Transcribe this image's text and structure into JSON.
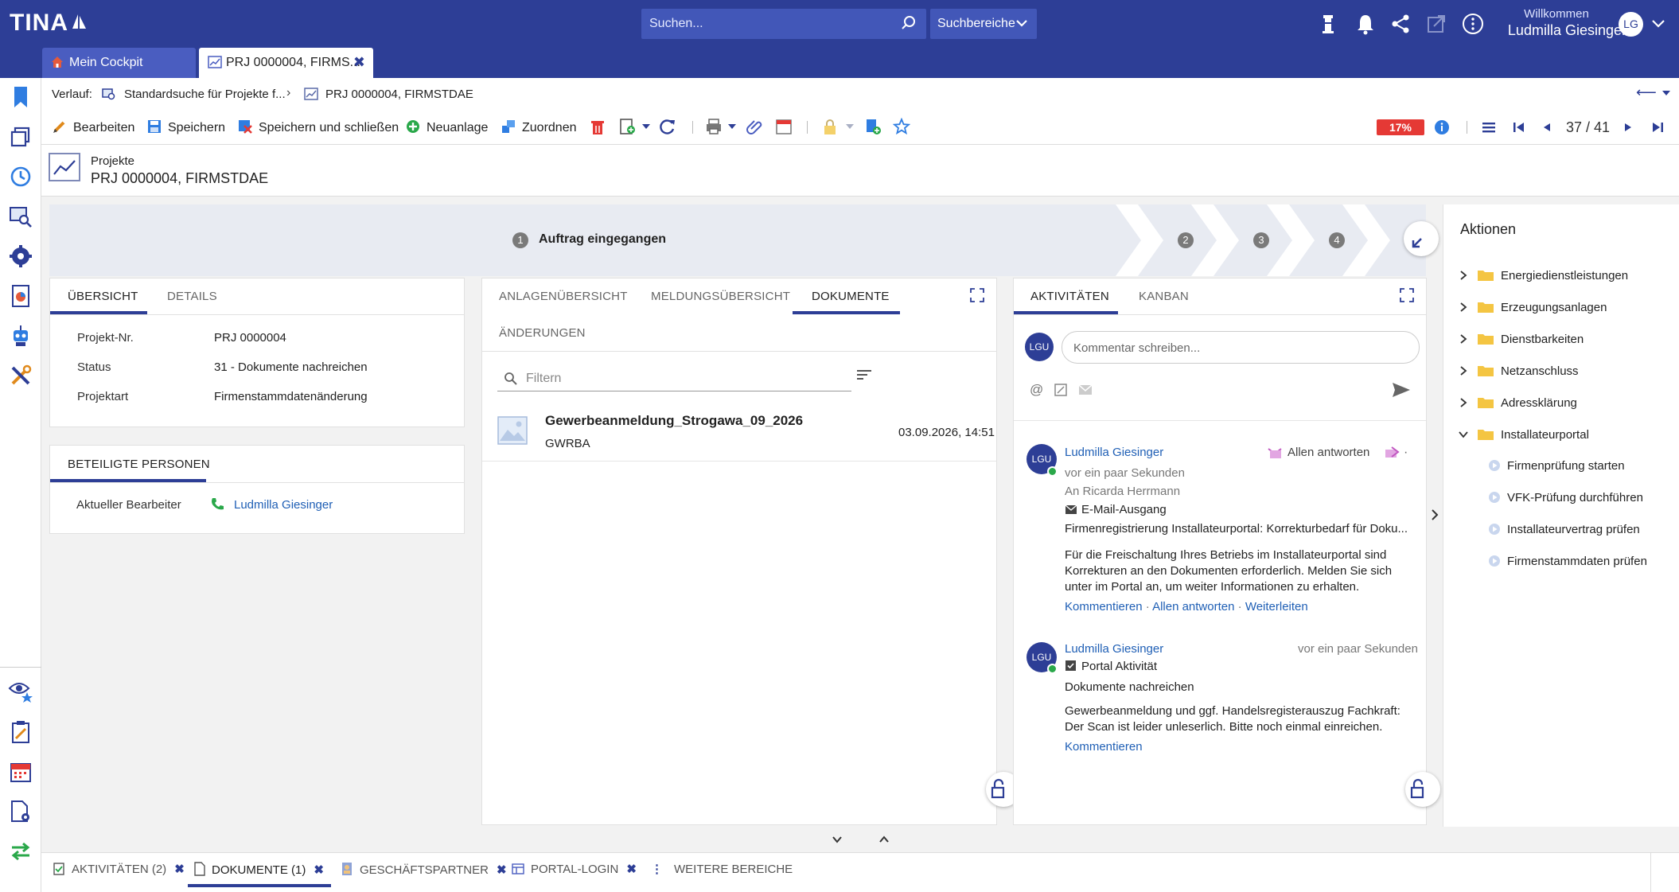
{
  "app": {
    "logo": "TINA"
  },
  "search": {
    "placeholder": "Suchen...",
    "areas_label": "Suchbereiche"
  },
  "user": {
    "welcome": "Willkommen",
    "name": "Ludmilla Giesinger",
    "initials": "LG"
  },
  "window_tabs": [
    {
      "label": "Mein Cockpit"
    },
    {
      "label": "PRJ 0000004, FIRMS..."
    }
  ],
  "breadcrumb": {
    "prefix": "Verlauf:",
    "items": [
      "Standardsuche für Projekte f...",
      "PRJ 0000004, FIRMSTDAE"
    ]
  },
  "toolbar": {
    "edit": "Bearbeiten",
    "save": "Speichern",
    "save_close": "Speichern und schließen",
    "new": "Neuanlage",
    "assign": "Zuordnen",
    "progress_badge": "17%",
    "pager": "37 / 41"
  },
  "record": {
    "type": "Projekte",
    "title": "PRJ 0000004, FIRMSTDAE"
  },
  "stages": [
    {
      "num": "1",
      "label": "Auftrag eingegangen"
    },
    {
      "num": "2"
    },
    {
      "num": "3"
    },
    {
      "num": "4"
    }
  ],
  "overview": {
    "tabs": [
      "ÜBERSICHT",
      "DETAILS"
    ],
    "fields": [
      {
        "label": "Projekt-Nr.",
        "value": "PRJ 0000004"
      },
      {
        "label": "Status",
        "value": "31 - Dokumente nachreichen"
      },
      {
        "label": "Projektart",
        "value": "Firmenstammdatenänderung"
      }
    ]
  },
  "persons": {
    "tab": "BETEILIGTE PERSONEN",
    "label": "Aktueller Bearbeiter",
    "value": "Ludmilla Giesinger"
  },
  "docs": {
    "tabs": [
      "ANLAGENÜBERSICHT",
      "MELDUNGSÜBERSICHT",
      "DOKUMENTE",
      "ÄNDERUNGEN"
    ],
    "filter_placeholder": "Filtern",
    "items": [
      {
        "title": "Gewerbeanmeldung_Strogawa_09_2026",
        "sub": "GWRBA",
        "date": "03.09.2026, 14:51"
      }
    ]
  },
  "activities": {
    "tabs": [
      "AKTIVITÄTEN",
      "KANBAN"
    ],
    "comment_avatar": "LGU",
    "comment_placeholder": "Kommentar schreiben...",
    "entries": [
      {
        "avatar": "LGU",
        "author": "Ludmilla Giesinger",
        "reply_all": "Allen antworten",
        "time": "vor ein paar Sekunden",
        "to": "An Ricarda Herrmann",
        "kind": "E-Mail-Ausgang",
        "subject": "Firmenregistrierung Installateurportal: Korrekturbedarf für Doku...",
        "body": "Für die Freischaltung Ihres Betriebs im Installateurportal sind Korrekturen an den Dokumenten erforderlich. Melden Sie sich unter im Portal an, um weiter Informationen zu erhalten.",
        "actions": [
          "Kommentieren",
          "Allen antworten",
          "Weiterleiten"
        ]
      },
      {
        "avatar": "LGU",
        "author": "Ludmilla Giesinger",
        "time": "vor ein paar Sekunden",
        "kind": "Portal Aktivität",
        "subject": "Dokumente nachreichen",
        "body": "Gewerbeanmeldung und ggf. Handelsregisterauszug Fachkraft: Der Scan ist leider unleserlich. Bitte noch einmal einreichen.",
        "actions": [
          "Kommentieren"
        ]
      }
    ]
  },
  "actions_panel": {
    "title": "Aktionen",
    "folders": [
      "Energiedienstleistungen",
      "Erzeugungsanlagen",
      "Dienstbarkeiten",
      "Netzanschluss",
      "Adressklärung",
      "Installateurportal"
    ],
    "subitems": [
      "Firmenprüfung starten",
      "VFK-Prüfung durchführen",
      "Installateurvertrag prüfen",
      "Firmenstammdaten prüfen"
    ]
  },
  "bottom_tabs": [
    "AKTIVITÄTEN (2)",
    "DOKUMENTE (1)",
    "GESCHÄFTSPARTNER",
    "PORTAL-LOGIN",
    "WEITERE BEREICHE"
  ],
  "colors": {
    "brand": "#2d3e96",
    "link": "#1f5fb5",
    "badge_red": "#e53935",
    "folder": "#f4c542"
  }
}
